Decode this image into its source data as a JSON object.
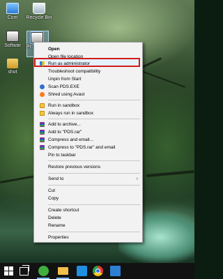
{
  "desktop": {
    "icons": [
      {
        "label": "Com"
      },
      {
        "label": "Recycle Bin"
      },
      {
        "label": "Softwar"
      },
      {
        "label": "Pr… Prov"
      },
      {
        "label": "shot"
      }
    ]
  },
  "context_menu": {
    "items": [
      {
        "label": "Open",
        "bold": true
      },
      {
        "label": "Open file location"
      },
      {
        "label": "Run as administrator",
        "icon": "uac-shield-icon",
        "highlighted": true
      },
      {
        "label": "Troubleshoot compatibility"
      },
      {
        "label": "Unpin from Start"
      },
      {
        "label": "Scan PDS.EXE",
        "icon": "defender-icon"
      },
      {
        "label": "Shred using Avast",
        "icon": "avast-icon"
      },
      {
        "label": "Run in sandbox",
        "icon": "sandbox-icon"
      },
      {
        "label": "Always run in sandbox",
        "icon": "sandbox-icon"
      },
      {
        "label": "Add to archive...",
        "icon": "winrar-icon"
      },
      {
        "label": "Add to \"PDS.rar\"",
        "icon": "winrar-icon"
      },
      {
        "label": "Compress and email...",
        "icon": "winrar-icon"
      },
      {
        "label": "Compress to \"PDS.rar\" and email",
        "icon": "winrar-icon"
      },
      {
        "label": "Pin to taskbar"
      },
      {
        "label": "Restore previous versions"
      },
      {
        "label": "Send to",
        "submenu": true
      },
      {
        "label": "Cut"
      },
      {
        "label": "Copy"
      },
      {
        "label": "Create shortcut"
      },
      {
        "label": "Delete"
      },
      {
        "label": "Rename"
      },
      {
        "label": "Properties"
      }
    ],
    "highlight_color": "#d11a1a"
  },
  "taskbar": {
    "apps": [
      "start-icon",
      "task-view-icon",
      "avast-icon",
      "file-explorer-icon",
      "store-icon",
      "chrome-icon",
      "photos-icon"
    ]
  }
}
